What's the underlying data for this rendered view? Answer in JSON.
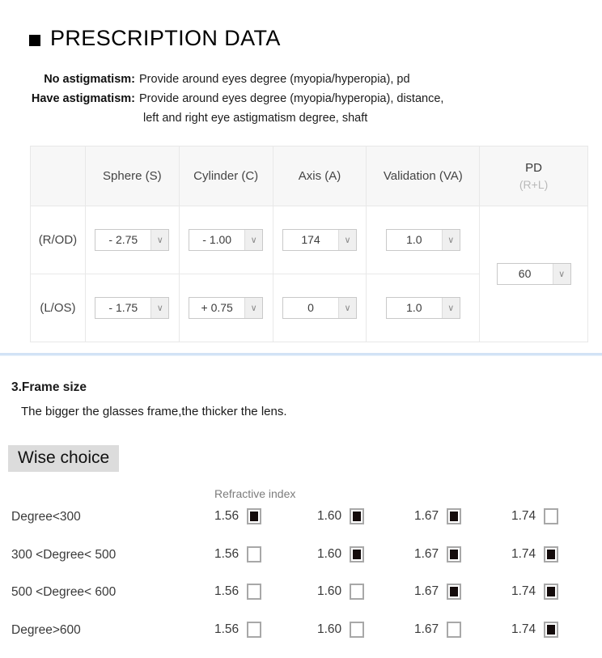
{
  "header": {
    "bullet": "black-square",
    "title": "PRESCRIPTION DATA"
  },
  "description": {
    "line1_label": "No astigmatism:",
    "line1_value": "Provide around eyes degree (myopia/hyperopia), pd",
    "line2_label": "Have astigmatism:",
    "line2_value": "Provide around eyes degree (myopia/hyperopia), distance,",
    "line2_value_cont": "left and right eye astigmatism degree, shaft"
  },
  "prescription_table": {
    "columns": {
      "corner": "",
      "sphere": "Sphere (S)",
      "cylinder": "Cylinder (C)",
      "axis": "Axis (A)",
      "validation": "Validation (VA)",
      "pd_main": "PD",
      "pd_sub": "(R+L)"
    },
    "rows": [
      {
        "side": "(R/OD)",
        "sphere": "- 2.75",
        "cylinder": "- 1.00",
        "axis": "174",
        "validation": "1.0"
      },
      {
        "side": "(L/OS)",
        "sphere": "- 1.75",
        "cylinder": "+ 0.75",
        "axis": "0",
        "validation": "1.0"
      }
    ],
    "pd_value": "60",
    "arrow_glyph": "∨"
  },
  "frame_size": {
    "heading": "3.Frame size",
    "note": "The bigger the glasses frame,the thicker the lens."
  },
  "wise_choice": {
    "label": "Wise choice"
  },
  "refractive": {
    "column_label": "Refractive index",
    "indices": [
      "1.56",
      "1.60",
      "1.67",
      "1.74"
    ],
    "rows": [
      {
        "degree": "Degree<300",
        "checked": [
          true,
          true,
          true,
          false
        ]
      },
      {
        "degree": "300 <Degree< 500",
        "checked": [
          false,
          true,
          true,
          true
        ]
      },
      {
        "degree": "500 <Degree< 600",
        "checked": [
          false,
          false,
          true,
          true
        ]
      },
      {
        "degree": "Degree>600",
        "checked": [
          false,
          false,
          false,
          true
        ]
      }
    ]
  },
  "colors": {
    "divider": "#c9ddf4",
    "header_bg": "#f7f7f7",
    "highlight_bg": "#dcdcdc",
    "checkbox_fill": "#140c0c",
    "muted_text": "#b9b9b9"
  }
}
